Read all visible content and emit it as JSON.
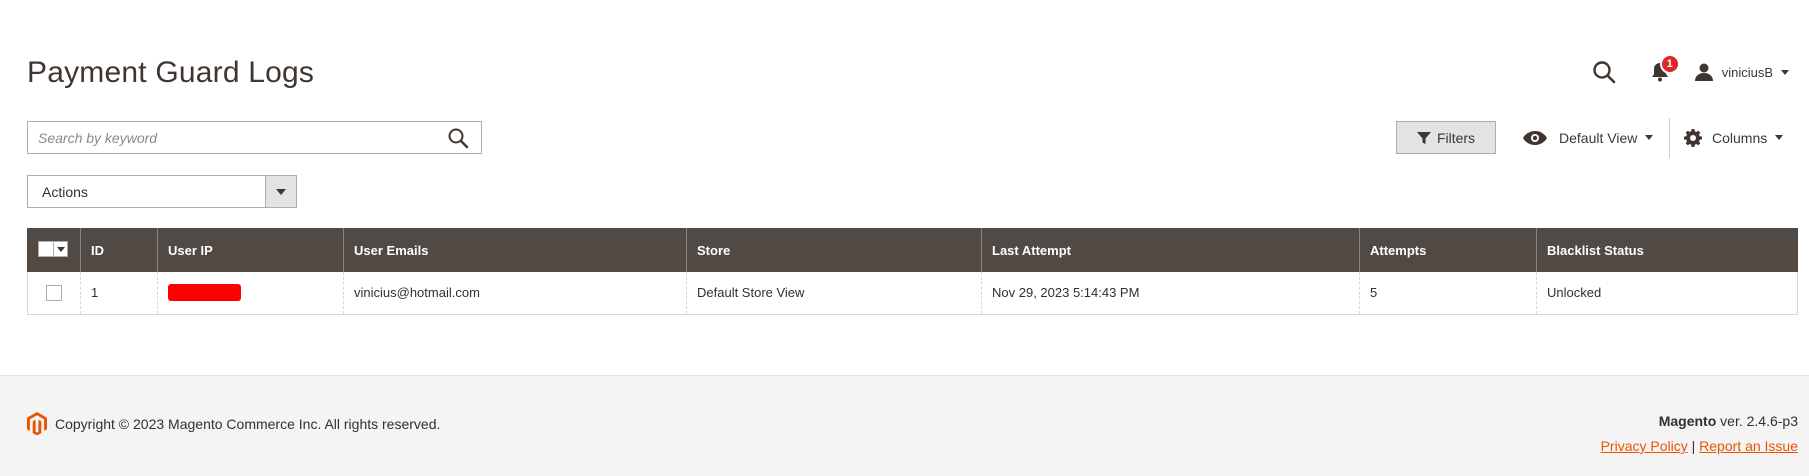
{
  "page": {
    "title": "Payment Guard Logs"
  },
  "header": {
    "notifications_count": "1",
    "username": "viniciusB",
    "icons": [
      "search-icon",
      "bell-icon",
      "user-icon"
    ]
  },
  "toolbar": {
    "search_placeholder": "Search by keyword",
    "filters_label": "Filters",
    "view_label": "Default View",
    "columns_label": "Columns",
    "actions_label": "Actions"
  },
  "grid": {
    "columns": [
      "ID",
      "User IP",
      "User Emails",
      "Store",
      "Last Attempt",
      "Attempts",
      "Blacklist Status"
    ],
    "rows": [
      {
        "id": "1",
        "user_ip": "",
        "user_email": "vinicius@hotmail.com",
        "store": "Default Store View",
        "last_attempt": "Nov 29, 2023 5:14:43 PM",
        "attempts": "5",
        "blacklist_status": "Unlocked"
      }
    ]
  },
  "footer": {
    "copyright": "Copyright © 2023 Magento Commerce Inc. All rights reserved.",
    "brand": "Magento",
    "version": "ver. 2.4.6-p3",
    "privacy_label": "Privacy Policy",
    "separator": "|",
    "report_label": "Report an Issue"
  },
  "colors": {
    "grid_header_bg": "#514943",
    "badge_red": "#e22626",
    "link_orange": "#eb5202",
    "redaction_red": "#ff0000"
  }
}
